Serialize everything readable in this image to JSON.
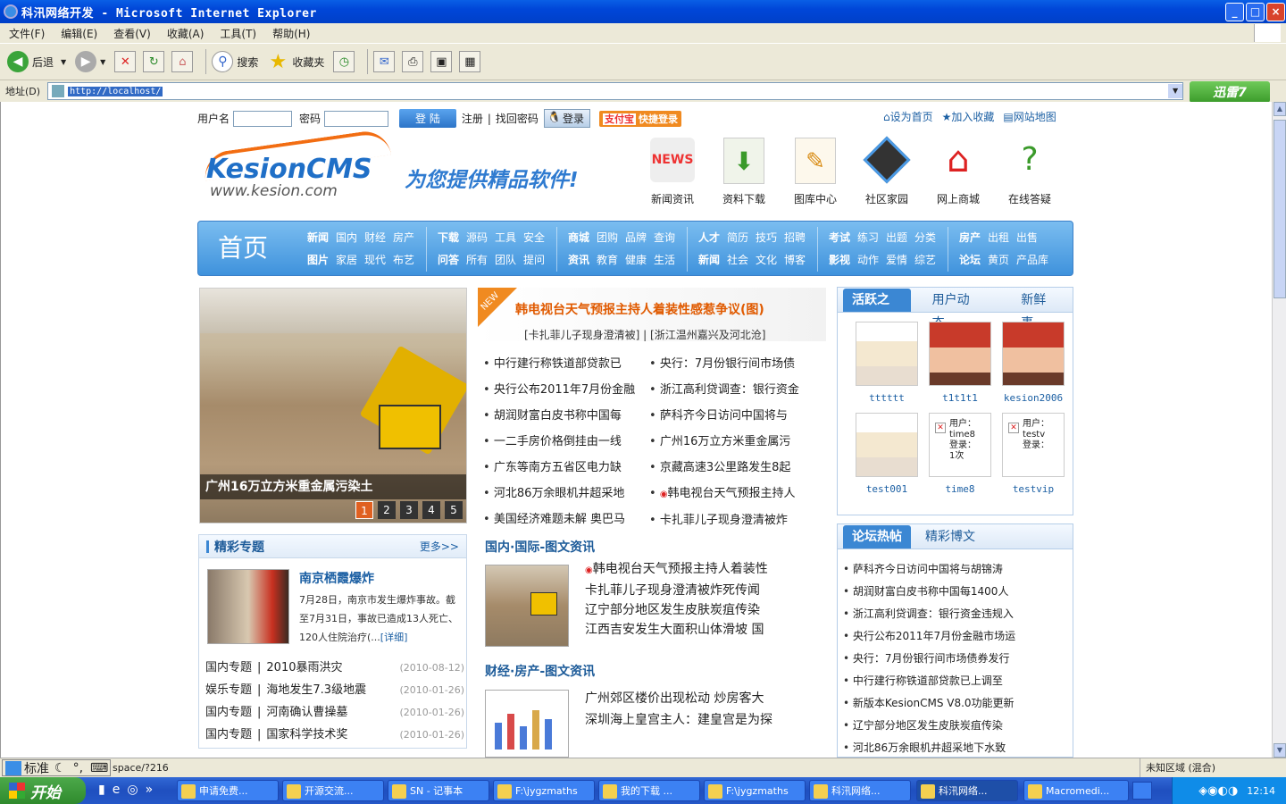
{
  "window": {
    "title": "科汛网络开发 - Microsoft Internet Explorer",
    "min": "_",
    "max": "□",
    "close": "×"
  },
  "menu": [
    "文件(F)",
    "编辑(E)",
    "查看(V)",
    "收藏(A)",
    "工具(T)",
    "帮助(H)"
  ],
  "toolbar": {
    "back": "后退",
    "search": "搜索",
    "favorites": "收藏夹"
  },
  "address": {
    "label": "地址(D)",
    "url": "http://localhost/",
    "go_button": "迅雷7"
  },
  "login": {
    "user_label": "用户名",
    "pass_label": "密码",
    "login_btn": "登 陆",
    "register": "注册",
    "forgot": "找回密码",
    "qq_login": "登录",
    "taobao_login": "快捷登录",
    "taobao": "支付宝"
  },
  "toplinks": [
    "设为首页",
    "加入收藏",
    "网站地图"
  ],
  "logo": {
    "brand": "KesionCMS",
    "url": "www.kesion.com",
    "slogan": "为您提供精品软件!"
  },
  "channels": [
    {
      "label": "新闻资讯",
      "icon": "news-icon"
    },
    {
      "label": "资料下载",
      "icon": "download-icon"
    },
    {
      "label": "图库中心",
      "icon": "gallery-icon"
    },
    {
      "label": "社区家园",
      "icon": "film-icon"
    },
    {
      "label": "网上商城",
      "icon": "house-icon"
    },
    {
      "label": "在线答疑",
      "icon": "question-icon"
    }
  ],
  "nav": {
    "home": "首页",
    "groups": [
      {
        "r1": [
          "新闻",
          "国内",
          "财经",
          "房产"
        ],
        "r2": [
          "图片",
          "家居",
          "现代",
          "布艺"
        ]
      },
      {
        "r1": [
          "下载",
          "源码",
          "工具",
          "安全"
        ],
        "r2": [
          "问答",
          "所有",
          "团队",
          "提问"
        ]
      },
      {
        "r1": [
          "商城",
          "团购",
          "品牌",
          "查询"
        ],
        "r2": [
          "资讯",
          "教育",
          "健康",
          "生活"
        ]
      },
      {
        "r1": [
          "人才",
          "简历",
          "技巧",
          "招聘"
        ],
        "r2": [
          "新闻",
          "社会",
          "文化",
          "博客"
        ]
      },
      {
        "r1": [
          "考试",
          "练习",
          "出题",
          "分类"
        ],
        "r2": [
          "影视",
          "动作",
          "爱情",
          "综艺"
        ]
      },
      {
        "r1": [
          "房产",
          "出租",
          "出售"
        ],
        "r2": [
          "论坛",
          "黄页",
          "产品库"
        ]
      }
    ]
  },
  "slide": {
    "caption": "广州16万立方米重金属污染土",
    "pages": [
      "1",
      "2",
      "3",
      "4",
      "5"
    ]
  },
  "headline": {
    "badge": "NEW",
    "title": "韩电视台天气预报主持人着装性感惹争议(图)",
    "sub": "[卡扎菲儿子现身澄清被] | [浙江温州嘉兴及河北沧]"
  },
  "news_left": [
    "中行建行称铁道部贷款已",
    "央行公布2011年7月份金融",
    "胡润财富白皮书称中国每",
    "一二手房价格倒挂由一线",
    "广东等南方五省区电力缺",
    "河北86万余眼机井超采地",
    "美国经济难题未解 奥巴马"
  ],
  "news_right": [
    "央行：7月份银行间市场债",
    "浙江高利贷调查：银行资金",
    "萨科齐今日访问中国将与",
    "广州16万立方米重金属污",
    "京藏高速3公里路发生8起",
    "韩电视台天气预报主持人",
    "卡扎菲儿子现身澄清被炸"
  ],
  "special": {
    "title": "精彩专题",
    "more": "更多>>",
    "feature_title": "南京栖霞爆炸",
    "feature_text": "7月28日，南京市发生爆炸事故。截至7月31日，事故已造成13人死亡、120人住院治疗(...",
    "detail": "[详细]",
    "items": [
      {
        "cat": "国内专题",
        "name": "2010暴雨洪灾",
        "date": "(2010-08-12)"
      },
      {
        "cat": "娱乐专题",
        "name": "海地发生7.3级地震",
        "date": "(2010-01-26)"
      },
      {
        "cat": "国内专题",
        "name": "河南确认曹操墓",
        "date": "(2010-01-26)"
      },
      {
        "cat": "国内专题",
        "name": "国家科学技术奖",
        "date": "(2010-01-26)"
      }
    ]
  },
  "intl": {
    "title": "国内·国际-图文资讯",
    "items": [
      "韩电视台天气预报主持人着装性",
      "卡扎菲儿子现身澄清被炸死传闻",
      "辽宁部分地区发生皮肤炭疽传染",
      "江西吉安发生大面积山体滑坡 国"
    ]
  },
  "finance": {
    "title": "财经·房产-图文资讯",
    "items": [
      "广州郊区楼价出现松动 炒房客大",
      "深圳海上皇宫主人：建皇宫是为探"
    ]
  },
  "users": {
    "tabs": [
      "活跃之星",
      "用户动态",
      "新鲜事"
    ],
    "list": [
      {
        "name": "tttttt",
        "type": "anime-girl"
      },
      {
        "name": "t1t1t1",
        "type": "anime-red"
      },
      {
        "name": "kesion2006",
        "type": "anime-red"
      },
      {
        "name": "test001",
        "type": "anime-girl"
      },
      {
        "name": "time8",
        "type": "broken",
        "t1": "用户：",
        "t2": "time8",
        "t3": "登录：",
        "t4": "1次"
      },
      {
        "name": "testvip",
        "type": "broken",
        "t1": "用户：",
        "t2": "testv",
        "t3": "登录：",
        "t4": ""
      }
    ]
  },
  "forum": {
    "tabs": [
      "论坛热帖",
      "精彩博文"
    ],
    "items": [
      "萨科齐今日访问中国将与胡锦涛",
      "胡润财富白皮书称中国每1400人",
      "浙江高利贷调查：银行资金违规入",
      "央行公布2011年7月份金融市场运",
      "央行：7月份银行间市场债券发行",
      "中行建行称铁道部贷款已上调至",
      "新版本KesionCMS V8.0功能更新",
      "辽宁部分地区发生皮肤炭疽传染",
      "河北86万余眼机井超采地下水致"
    ]
  },
  "status": {
    "text": "space/?216",
    "zone": "未知区域 (混合)",
    "ime": "标准"
  },
  "taskbar": {
    "start": "开始",
    "tasks": [
      "申请免费...",
      "开源交流...",
      "SN - 记事本",
      "F:\\jygzmaths",
      "我的下载 ...",
      "F:\\jygzmaths",
      "科汛网络...",
      "科汛网络...",
      "Macromedi..."
    ],
    "time": "12:14"
  }
}
